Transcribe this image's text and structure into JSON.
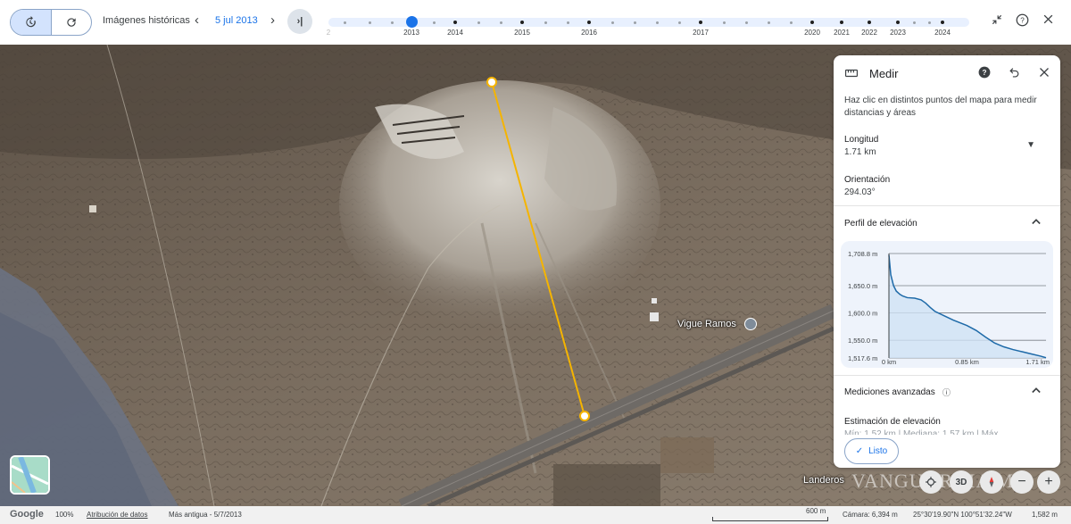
{
  "toolbar": {
    "history_icon": "history-icon",
    "refresh_icon": "refresh-icon",
    "historical_label": "Imágenes históricas",
    "prev_icon": "chevron-left-icon",
    "date": "5 jul 2013",
    "next_icon": "chevron-right-icon",
    "latest_icon": "skip-to-latest-icon",
    "collapse_icon": "collapse-icon",
    "help_icon": "help-icon",
    "close_icon": "close-icon",
    "years": [
      "2",
      "2013",
      "2014",
      "2015",
      "2016",
      "2017",
      "2020",
      "2021",
      "2022",
      "2023",
      "2024"
    ]
  },
  "panel": {
    "title": "Medir",
    "instructions": "Haz clic en distintos puntos del mapa para medir distancias y áreas",
    "length_label": "Longitud",
    "length_value": "1.71 km",
    "orientation_label": "Orientación",
    "orientation_value": "294.03°",
    "elevation_section": "Perfil de elevación",
    "advanced_section": "Mediciones avanzadas",
    "elevation_estimate_label": "Estimación de elevación",
    "elevation_estimate_value": "Mín: 1,52 km | Mediana: 1,57 km | Máx",
    "done_label": "Listo"
  },
  "chart_data": {
    "type": "area",
    "xlabel": "",
    "ylabel": "",
    "y_tick_labels": [
      "1,708.8 m",
      "1,650.0 m",
      "1,600.0 m",
      "1,550.0 m",
      "1,517.6 m"
    ],
    "x_tick_labels": [
      "0 km",
      "0.85 km",
      "1.71 km"
    ],
    "ylim": [
      1517.6,
      1708.8
    ],
    "xlim": [
      0,
      1.71
    ],
    "series": [
      {
        "x": [
          0,
          0.02,
          0.05,
          0.08,
          0.12,
          0.15,
          0.2,
          0.28,
          0.35,
          0.4,
          0.45,
          0.5,
          0.6,
          0.7,
          0.85,
          0.95,
          1.05,
          1.15,
          1.25,
          1.35,
          1.45,
          1.55,
          1.65,
          1.71
        ],
        "y": [
          1706,
          1670,
          1650,
          1640,
          1634,
          1631,
          1628,
          1627,
          1624,
          1618,
          1610,
          1603,
          1595,
          1587,
          1577,
          1568,
          1556,
          1545,
          1538,
          1533,
          1529,
          1525,
          1521,
          1518
        ]
      }
    ]
  },
  "map": {
    "place_label": "Vigue Ramos",
    "place_label2": "Landeros",
    "watermark": "VANGUARDIA MX"
  },
  "controls": {
    "locate_icon": "locate-icon",
    "view_3d": "3D",
    "compass_icon": "compass-icon",
    "zoom_out": "−",
    "zoom_in": "+"
  },
  "status": {
    "brand": "Google",
    "zoom": "100%",
    "attribution": "Atribución de datos",
    "oldest": "Más antigua - 5/7/2013",
    "scale": "600 m",
    "camera": "Cámara: 6,394 m",
    "coords": "25°30'19.90\"N 100°51'32.24\"W",
    "altitude": "1,582 m"
  },
  "colors": {
    "accent": "#1a73e8",
    "measure_line": "#f5b400",
    "elevation_line": "#1e6aa8"
  }
}
